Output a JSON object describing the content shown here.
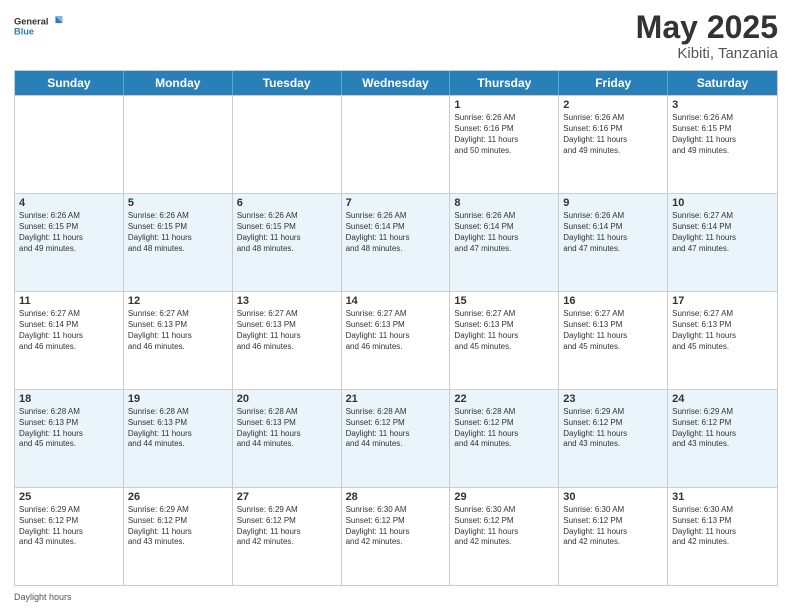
{
  "logo": {
    "general": "General",
    "blue": "Blue"
  },
  "title": "May 2025",
  "location": "Kibiti, Tanzania",
  "days_of_week": [
    "Sunday",
    "Monday",
    "Tuesday",
    "Wednesday",
    "Thursday",
    "Friday",
    "Saturday"
  ],
  "footer_text": "Daylight hours",
  "rows": [
    [
      {
        "day": "",
        "lines": []
      },
      {
        "day": "",
        "lines": []
      },
      {
        "day": "",
        "lines": []
      },
      {
        "day": "",
        "lines": []
      },
      {
        "day": "1",
        "lines": [
          "Sunrise: 6:26 AM",
          "Sunset: 6:16 PM",
          "Daylight: 11 hours",
          "and 50 minutes."
        ]
      },
      {
        "day": "2",
        "lines": [
          "Sunrise: 6:26 AM",
          "Sunset: 6:16 PM",
          "Daylight: 11 hours",
          "and 49 minutes."
        ]
      },
      {
        "day": "3",
        "lines": [
          "Sunrise: 6:26 AM",
          "Sunset: 6:15 PM",
          "Daylight: 11 hours",
          "and 49 minutes."
        ]
      }
    ],
    [
      {
        "day": "4",
        "lines": [
          "Sunrise: 6:26 AM",
          "Sunset: 6:15 PM",
          "Daylight: 11 hours",
          "and 49 minutes."
        ]
      },
      {
        "day": "5",
        "lines": [
          "Sunrise: 6:26 AM",
          "Sunset: 6:15 PM",
          "Daylight: 11 hours",
          "and 48 minutes."
        ]
      },
      {
        "day": "6",
        "lines": [
          "Sunrise: 6:26 AM",
          "Sunset: 6:15 PM",
          "Daylight: 11 hours",
          "and 48 minutes."
        ]
      },
      {
        "day": "7",
        "lines": [
          "Sunrise: 6:26 AM",
          "Sunset: 6:14 PM",
          "Daylight: 11 hours",
          "and 48 minutes."
        ]
      },
      {
        "day": "8",
        "lines": [
          "Sunrise: 6:26 AM",
          "Sunset: 6:14 PM",
          "Daylight: 11 hours",
          "and 47 minutes."
        ]
      },
      {
        "day": "9",
        "lines": [
          "Sunrise: 6:26 AM",
          "Sunset: 6:14 PM",
          "Daylight: 11 hours",
          "and 47 minutes."
        ]
      },
      {
        "day": "10",
        "lines": [
          "Sunrise: 6:27 AM",
          "Sunset: 6:14 PM",
          "Daylight: 11 hours",
          "and 47 minutes."
        ]
      }
    ],
    [
      {
        "day": "11",
        "lines": [
          "Sunrise: 6:27 AM",
          "Sunset: 6:14 PM",
          "Daylight: 11 hours",
          "and 46 minutes."
        ]
      },
      {
        "day": "12",
        "lines": [
          "Sunrise: 6:27 AM",
          "Sunset: 6:13 PM",
          "Daylight: 11 hours",
          "and 46 minutes."
        ]
      },
      {
        "day": "13",
        "lines": [
          "Sunrise: 6:27 AM",
          "Sunset: 6:13 PM",
          "Daylight: 11 hours",
          "and 46 minutes."
        ]
      },
      {
        "day": "14",
        "lines": [
          "Sunrise: 6:27 AM",
          "Sunset: 6:13 PM",
          "Daylight: 11 hours",
          "and 46 minutes."
        ]
      },
      {
        "day": "15",
        "lines": [
          "Sunrise: 6:27 AM",
          "Sunset: 6:13 PM",
          "Daylight: 11 hours",
          "and 45 minutes."
        ]
      },
      {
        "day": "16",
        "lines": [
          "Sunrise: 6:27 AM",
          "Sunset: 6:13 PM",
          "Daylight: 11 hours",
          "and 45 minutes."
        ]
      },
      {
        "day": "17",
        "lines": [
          "Sunrise: 6:27 AM",
          "Sunset: 6:13 PM",
          "Daylight: 11 hours",
          "and 45 minutes."
        ]
      }
    ],
    [
      {
        "day": "18",
        "lines": [
          "Sunrise: 6:28 AM",
          "Sunset: 6:13 PM",
          "Daylight: 11 hours",
          "and 45 minutes."
        ]
      },
      {
        "day": "19",
        "lines": [
          "Sunrise: 6:28 AM",
          "Sunset: 6:13 PM",
          "Daylight: 11 hours",
          "and 44 minutes."
        ]
      },
      {
        "day": "20",
        "lines": [
          "Sunrise: 6:28 AM",
          "Sunset: 6:13 PM",
          "Daylight: 11 hours",
          "and 44 minutes."
        ]
      },
      {
        "day": "21",
        "lines": [
          "Sunrise: 6:28 AM",
          "Sunset: 6:12 PM",
          "Daylight: 11 hours",
          "and 44 minutes."
        ]
      },
      {
        "day": "22",
        "lines": [
          "Sunrise: 6:28 AM",
          "Sunset: 6:12 PM",
          "Daylight: 11 hours",
          "and 44 minutes."
        ]
      },
      {
        "day": "23",
        "lines": [
          "Sunrise: 6:29 AM",
          "Sunset: 6:12 PM",
          "Daylight: 11 hours",
          "and 43 minutes."
        ]
      },
      {
        "day": "24",
        "lines": [
          "Sunrise: 6:29 AM",
          "Sunset: 6:12 PM",
          "Daylight: 11 hours",
          "and 43 minutes."
        ]
      }
    ],
    [
      {
        "day": "25",
        "lines": [
          "Sunrise: 6:29 AM",
          "Sunset: 6:12 PM",
          "Daylight: 11 hours",
          "and 43 minutes."
        ]
      },
      {
        "day": "26",
        "lines": [
          "Sunrise: 6:29 AM",
          "Sunset: 6:12 PM",
          "Daylight: 11 hours",
          "and 43 minutes."
        ]
      },
      {
        "day": "27",
        "lines": [
          "Sunrise: 6:29 AM",
          "Sunset: 6:12 PM",
          "Daylight: 11 hours",
          "and 42 minutes."
        ]
      },
      {
        "day": "28",
        "lines": [
          "Sunrise: 6:30 AM",
          "Sunset: 6:12 PM",
          "Daylight: 11 hours",
          "and 42 minutes."
        ]
      },
      {
        "day": "29",
        "lines": [
          "Sunrise: 6:30 AM",
          "Sunset: 6:12 PM",
          "Daylight: 11 hours",
          "and 42 minutes."
        ]
      },
      {
        "day": "30",
        "lines": [
          "Sunrise: 6:30 AM",
          "Sunset: 6:12 PM",
          "Daylight: 11 hours",
          "and 42 minutes."
        ]
      },
      {
        "day": "31",
        "lines": [
          "Sunrise: 6:30 AM",
          "Sunset: 6:13 PM",
          "Daylight: 11 hours",
          "and 42 minutes."
        ]
      }
    ]
  ]
}
